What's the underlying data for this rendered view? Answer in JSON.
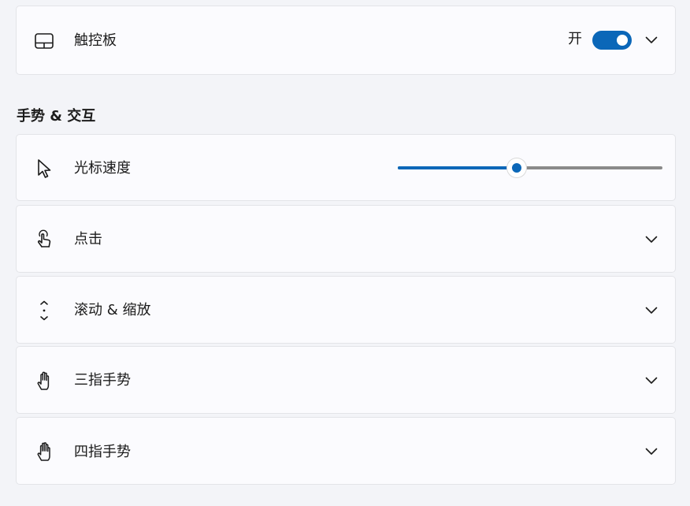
{
  "touchpad": {
    "label": "触控板",
    "state_text": "开",
    "enabled": true
  },
  "gestures_section": {
    "title": "手势 & 交互"
  },
  "cursor_speed": {
    "label": "光标速度",
    "value_fraction": 0.45
  },
  "rows": [
    {
      "label": "点击",
      "icon": "touch-tap-icon"
    },
    {
      "label": "滚动 & 缩放",
      "icon": "scroll-arrows-icon"
    },
    {
      "label": "三指手势",
      "icon": "three-finger-hand-icon"
    },
    {
      "label": "四指手势",
      "icon": "four-finger-hand-icon"
    }
  ],
  "colors": {
    "accent": "#0b67b8",
    "background": "#f3f4f8",
    "card": "#fbfbfe",
    "slider_track": "#8a8a8a"
  }
}
